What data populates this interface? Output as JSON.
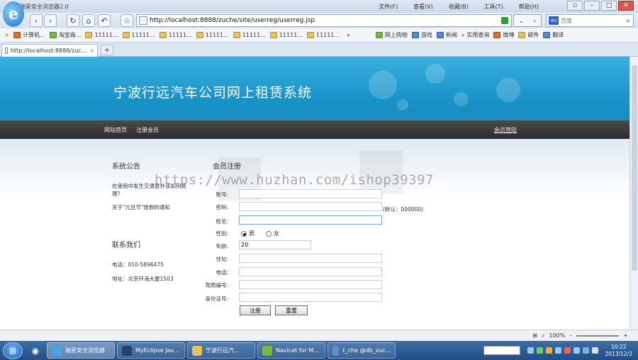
{
  "browser": {
    "title": "瑞星安全浏览器2.0",
    "menus": [
      "文件(F)",
      "查看(V)",
      "收藏(B)",
      "工具(T)",
      "帮助(H)"
    ],
    "address": "http://localhost:8888/zuche/site/userreg/userreg.jsp",
    "search_placeholder": "百度",
    "favorites": [
      "计算机...",
      "淘宝商...",
      "11111...",
      "11111...",
      "11111...",
      "11111...",
      "11111...",
      "11111...",
      "11111...",
      "»",
      "网上购物",
      "游戏",
      "新闻",
      "实用查询",
      "微博",
      "邮件",
      "翻译"
    ],
    "tab_label": "http://localhost:8888/zuc...",
    "tab_close": "×",
    "new_tab": "+"
  },
  "site": {
    "title": "宁波行远汽车公司网上租赁系统",
    "nav": [
      "网站首页",
      "注册会员"
    ],
    "nav_right": "会员登陆"
  },
  "sidebar": {
    "notice_title": "系统公告",
    "notices": [
      "在使用中发生交通意外该如何处理?",
      "关于\"元旦节\"放假的通知"
    ],
    "contact_title": "联系我们",
    "phone": "电话：010-5896475",
    "address": "地址：北京环海大厦1503"
  },
  "form": {
    "title": "会员注册",
    "fields": [
      {
        "label": "账号:",
        "value": ""
      },
      {
        "label": "密码:",
        "value": "",
        "hint": "(默认：000000)"
      },
      {
        "label": "姓名:",
        "value": ""
      },
      {
        "label": "性别:",
        "options": [
          "男",
          "女"
        ],
        "selected": "男"
      },
      {
        "label": "年龄:",
        "value": "20"
      },
      {
        "label": "住址:",
        "value": ""
      },
      {
        "label": "电话:",
        "value": ""
      },
      {
        "label": "驾照编号:",
        "value": ""
      },
      {
        "label": "身份证号:",
        "value": ""
      }
    ],
    "submit": "注册",
    "reset": "重置"
  },
  "watermark": "https://www.huzhan.com/ishop39397",
  "statusbar": {
    "zoom": "100%"
  },
  "taskbar": {
    "items": [
      "瑞星安全浏览器",
      "MyEclipse Jav...",
      "宁波行远汽...",
      "Navicat for M...",
      "t_che @db_zuc..."
    ],
    "time": "10:22",
    "date": "2013/12/2"
  }
}
